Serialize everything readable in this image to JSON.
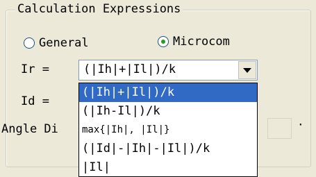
{
  "group": {
    "title": "Calculation Expressions"
  },
  "radios": [
    {
      "label": "General",
      "checked": false
    },
    {
      "label": "Microcom",
      "checked": true
    }
  ],
  "ir": {
    "label": "Ir =",
    "value": "(|Ih|+|Il|)/k"
  },
  "id": {
    "label": "Id ="
  },
  "angle": {
    "label": "Angle Di"
  },
  "period": "·",
  "dropdown": {
    "options": [
      "(|Ih|+|Il|)/k",
      "(|Ih-Il|)/k",
      "max{|Ih|, |Il|}",
      "(|Id|-|Ih|-|Il|)/k",
      "|Il|"
    ],
    "selected_index": 0
  },
  "colors": {
    "highlight": "#316ac5",
    "radio_dot": "#21a121",
    "window_bg": "#ece9d8"
  },
  "icons": {
    "combo_arrow": "chevron-down-icon"
  }
}
